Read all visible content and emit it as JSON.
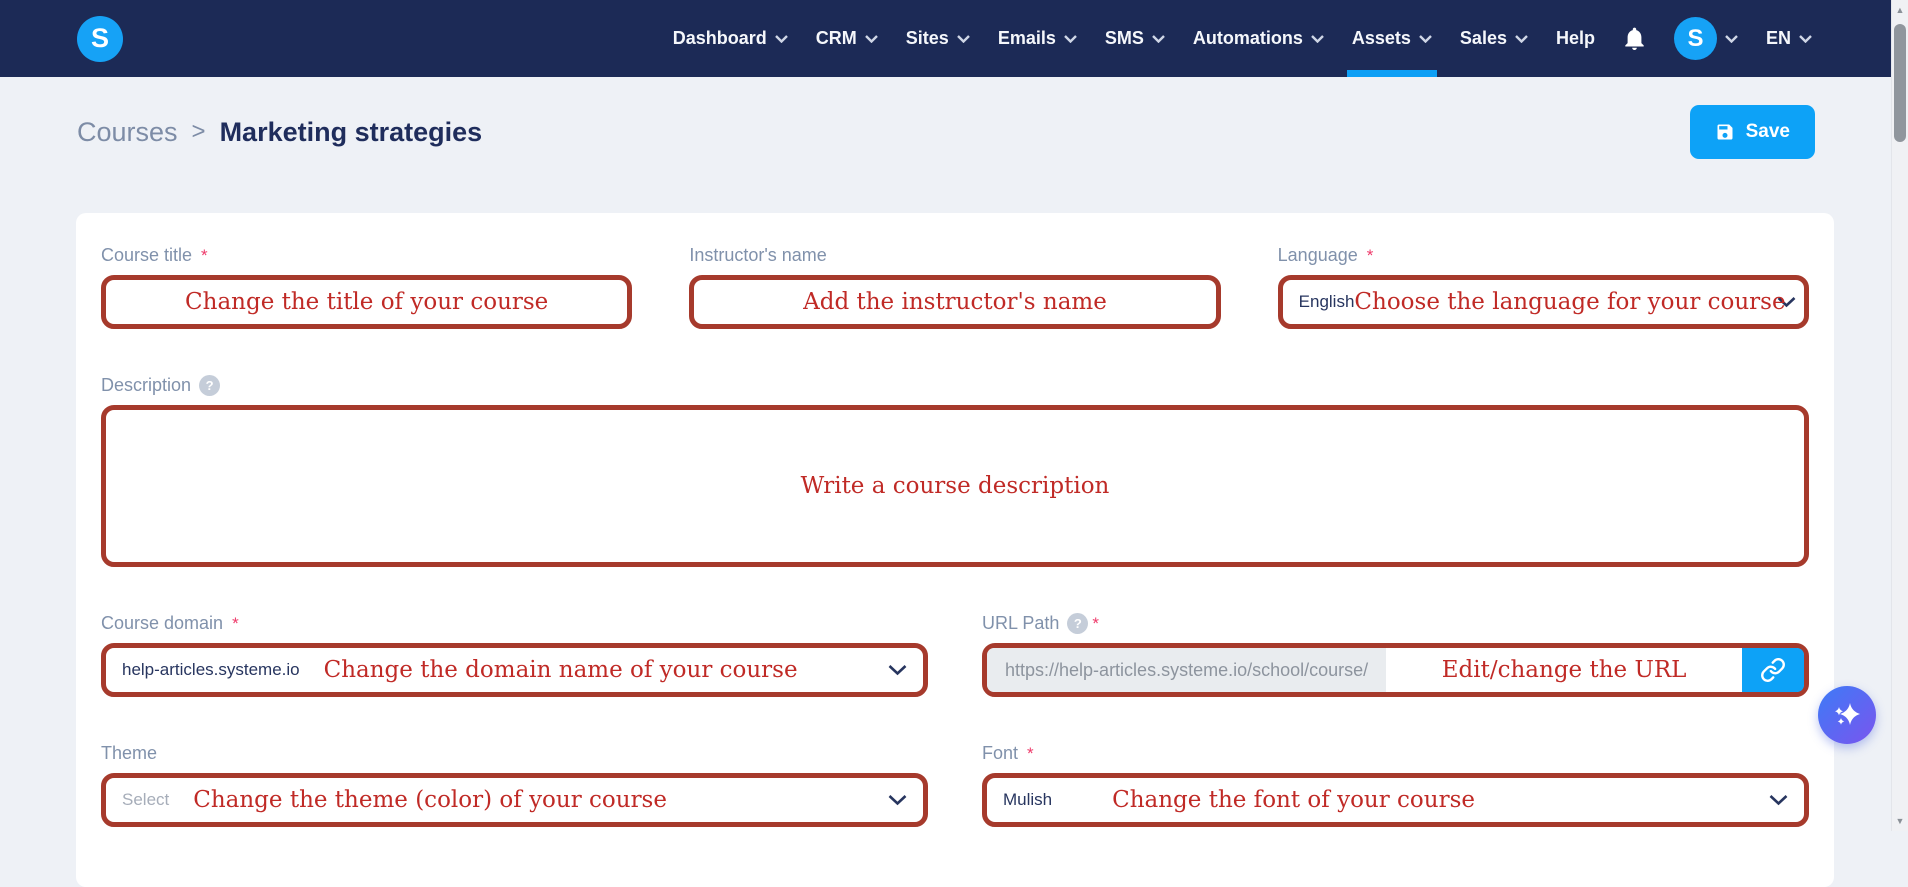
{
  "nav": {
    "logo_letter": "S",
    "items": [
      {
        "label": "Dashboard"
      },
      {
        "label": "CRM"
      },
      {
        "label": "Sites"
      },
      {
        "label": "Emails"
      },
      {
        "label": "SMS"
      },
      {
        "label": "Automations"
      },
      {
        "label": "Assets",
        "active": true
      },
      {
        "label": "Sales"
      },
      {
        "label": "Help"
      }
    ],
    "avatar_letter": "S",
    "locale": "EN"
  },
  "header": {
    "breadcrumb_parent": "Courses",
    "breadcrumb_separator": ">",
    "breadcrumb_current": "Marketing strategies",
    "save_label": "Save"
  },
  "form": {
    "course_title": {
      "label": "Course title",
      "annotation": "Change the title of your course"
    },
    "instructor": {
      "label": "Instructor's name",
      "annotation": "Add the instructor's name"
    },
    "language": {
      "label": "Language",
      "value": "English",
      "annotation": "Choose the language for your course"
    },
    "description": {
      "label": "Description",
      "annotation": "Write a course description"
    },
    "domain": {
      "label": "Course domain",
      "value": "help-articles.systeme.io",
      "annotation": "Change the domain name of your course"
    },
    "url": {
      "label": "URL Path",
      "prefix": "https://help-articles.systeme.io/school/course/",
      "annotation": "Edit/change the URL"
    },
    "theme": {
      "label": "Theme",
      "placeholder": "Select",
      "annotation": "Change the theme (color) of your course"
    },
    "font": {
      "label": "Font",
      "value": "Mulish",
      "annotation": "Change the font of your course"
    }
  },
  "misc": {
    "required": "*",
    "help": "?",
    "scroll_up": "▲",
    "scroll_down": "▼"
  },
  "colors": {
    "nav_navy": "#1c2a56",
    "accent_blue": "#0da2f7",
    "annotation_border": "#a63a2c",
    "annotation_red": "#c02a26",
    "page_bg": "#eef1f6"
  }
}
